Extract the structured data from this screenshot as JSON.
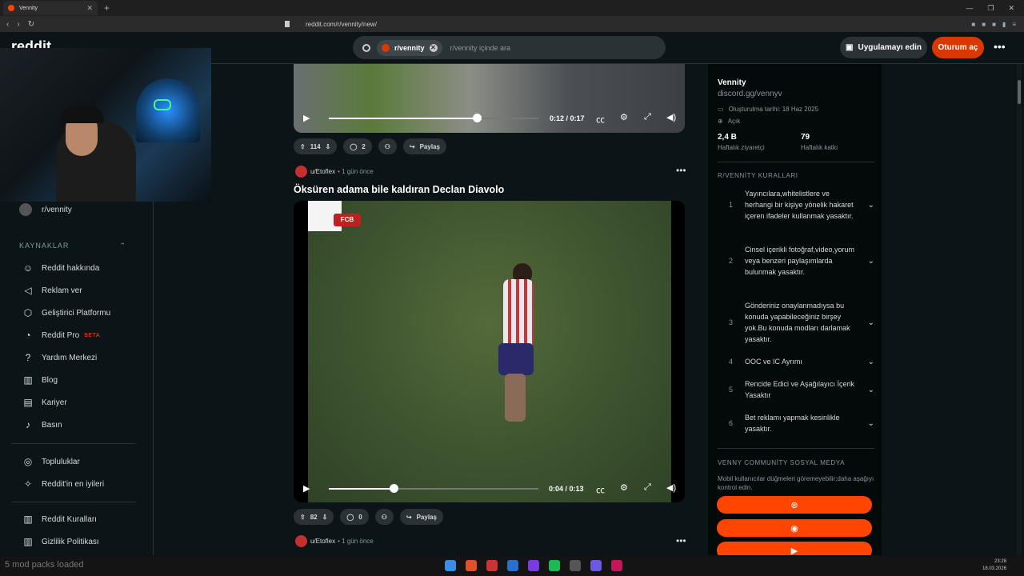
{
  "browser": {
    "tab_title": "Vennity",
    "url": "reddit.com/r/vennity/new/"
  },
  "header": {
    "logo": "reddit",
    "search_chip": "r/vennity",
    "search_placeholder": "r/vennity içinde ara",
    "app_button": "Uygulamayı edin",
    "login_button": "Oturum aç"
  },
  "sidebar": {
    "sub_item": "r/vennity",
    "section_title": "KAYNAKLAR",
    "items": [
      {
        "label": "Reddit hakkında",
        "icon": "reddit-alien-icon"
      },
      {
        "label": "Reklam ver",
        "icon": "megaphone-icon"
      },
      {
        "label": "Geliştirici Platformu",
        "icon": "dev-platform-icon"
      },
      {
        "label": "Reddit Pro",
        "icon": "pro-icon",
        "badge": "BETA"
      },
      {
        "label": "Yardım Merkezi",
        "icon": "help-icon"
      },
      {
        "label": "Blog",
        "icon": "book-icon"
      },
      {
        "label": "Kariyer",
        "icon": "briefcase-icon"
      },
      {
        "label": "Basın",
        "icon": "microphone-icon"
      }
    ],
    "items2": [
      {
        "label": "Topluluklar",
        "icon": "communities-icon"
      },
      {
        "label": "Reddit'in en iyileri",
        "icon": "best-of-icon"
      }
    ],
    "items3": [
      {
        "label": "Reddit Kuralları",
        "icon": "rules-icon"
      },
      {
        "label": "Gizlilik Politikası",
        "icon": "privacy-icon"
      }
    ]
  },
  "post1": {
    "time": "0:12 / 0:17",
    "progress": 0.706,
    "votes": "114",
    "comments": "2",
    "share": "Paylaş"
  },
  "post2": {
    "author": "u/Etoflex",
    "age": "• 1 gün önce",
    "title": "Öksüren adama bile kaldıran Declan Diavolo",
    "time": "0:04 / 0:13",
    "progress": 0.308,
    "votes": "82",
    "comments": "0",
    "share": "Paylaş",
    "video_badge": "FCB"
  },
  "post3": {
    "author": "u/Etoflex",
    "age": "• 1 gün önce"
  },
  "community": {
    "name": "Vennity",
    "subtitle": "discord.gg/vennyv",
    "created": "Oluşturulma tarihi: 18 Haz 2025",
    "visibility": "Açık",
    "visitors_value": "2,4 B",
    "visitors_label": "Haftalık ziyaretçi",
    "contrib_value": "79",
    "contrib_label": "Haftalık katkı",
    "rules_title": "R/VENNİTY KURALLARI",
    "rules": [
      {
        "n": "1",
        "text": "Yayıncılara,whitelistlere ve herhangi bir kişiye yönelik hakaret içeren ifadeler kullanmak yasaktır."
      },
      {
        "n": "2",
        "text": "Cinsel içerikli fotoğraf,video,yorum veya benzeri paylaşımlarda bulunmak yasaktır."
      },
      {
        "n": "3",
        "text": "Gönderiniz onaylanmadıysa bu konuda yapabileceğiniz birşey yok.Bu konuda modları darlamak yasaktır."
      },
      {
        "n": "4",
        "text": "OOC ve IC Ayrımı"
      },
      {
        "n": "5",
        "text": "Rencide Edici ve Aşağılayıcı İçerik Yasaktır"
      },
      {
        "n": "6",
        "text": "Bet reklamı yapmak kesinlikle yasaktır."
      }
    ],
    "social_title": "VENNY COMMUNİTY SOSYAL MEDYA",
    "social_desc": "Mobil kullanıcılar düğmeleri göremeyebilir;daha aşağıyı kontrol edin."
  },
  "taskbar": {
    "mods": "5 mod packs loaded",
    "time": "23:28",
    "date": "18.03.2026"
  },
  "colors": {
    "accent": "#ff4500",
    "login": "#d93900",
    "background": "#0b1416"
  }
}
